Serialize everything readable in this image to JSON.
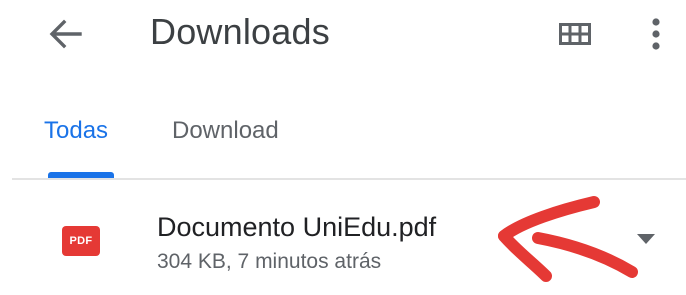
{
  "appbar": {
    "title": "Downloads",
    "back_icon": "arrow-back-icon",
    "grid_icon": "grid-view-icon",
    "more_icon": "more-vert-icon"
  },
  "tabs": [
    {
      "label": "Todas",
      "selected": true
    },
    {
      "label": "Download",
      "selected": false
    }
  ],
  "files": [
    {
      "icon_label": "PDF",
      "name": "Documento UniEdu.pdf",
      "meta": "304 KB, 7 minutos atrás",
      "expand_icon": "arrow-drop-down-icon"
    }
  ],
  "colors": {
    "accent": "#1a73e8",
    "pdf_icon": "#e53935",
    "annotation": "#e53935"
  }
}
